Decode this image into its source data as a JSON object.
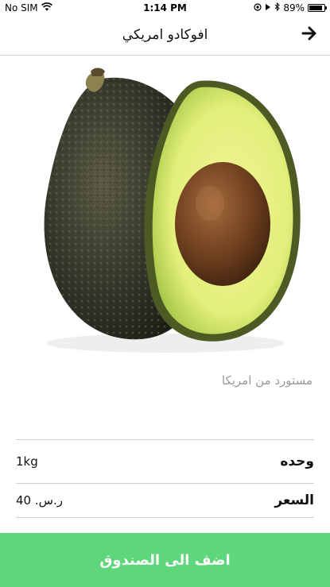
{
  "status_bar": {
    "carrier": "No SIM",
    "time": "1:14 PM",
    "battery_percent": "89%",
    "battery_level": 0.89,
    "icons": [
      "wifi-icon",
      "location-icon",
      "alarm-icon",
      "bluetooth-icon",
      "battery-icon"
    ]
  },
  "nav": {
    "title": "افوكادو امريكي",
    "back_icon": "arrow-right-icon"
  },
  "product": {
    "image": "avocado-image",
    "description": "مستورد من امريكا"
  },
  "details": [
    {
      "label": "وحده",
      "value": "1kg"
    },
    {
      "label": "السعر",
      "value": "ر.س. 40"
    }
  ],
  "actions": {
    "add_to_cart": "اضف الى الصندوق"
  },
  "colors": {
    "accent": "#5ed67a",
    "divider": "#cfcfcf",
    "muted_text": "#9a9a9a"
  }
}
